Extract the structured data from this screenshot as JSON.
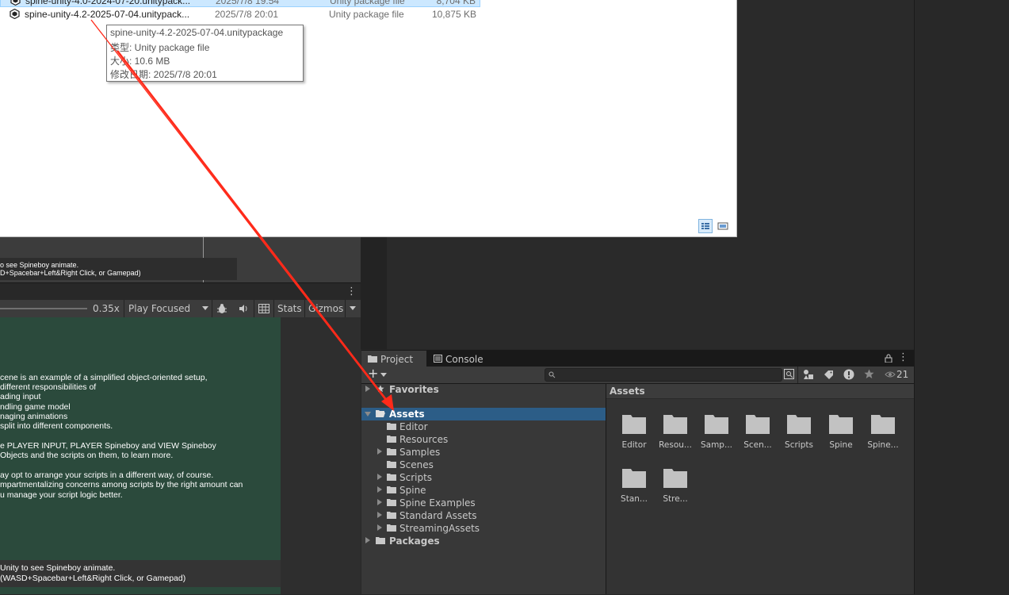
{
  "explorer": {
    "files": [
      {
        "name": "spine-unity-4.0-2024-07-20.unitypack...",
        "date": "2025/7/8 19:54",
        "type": "Unity package file",
        "size": "8,704 KB",
        "selected": true
      },
      {
        "name": "spine-unity-4.2-2025-07-04.unitypack...",
        "date": "2025/7/8 20:01",
        "type": "Unity package file",
        "size": "10,875 KB",
        "selected": false
      }
    ],
    "tooltip": {
      "name": "spine-unity-4.2-2025-07-04.unitypackage",
      "type_line": "类型: Unity package file",
      "size_line": "大小: 10.6 MB",
      "date_line": "修改日期: 2025/7/8 20:01"
    }
  },
  "scene": {
    "hint_line1": "o see Spineboy animate.",
    "hint_line2": "D+Spacebar+Left&Right Click, or Gamepad)"
  },
  "game_toolbar": {
    "scale": "0.35x",
    "play_mode": "Play Focused",
    "stats": "Stats",
    "gizmos": "Gizmos"
  },
  "game_view": {
    "lines": [
      "cene is an example of a simplified object-oriented setup,",
      "different responsibilities of",
      "ading input",
      "ndling game model",
      "naging animations",
      "split into different components.",
      "e PLAYER INPUT, PLAYER Spineboy and VIEW Spineboy",
      "Objects and the scripts on them, to learn more.",
      "ay opt to arrange your scripts in a different way, of course.",
      "mpartmentalizing concerns among scripts by the right amount can",
      "u manage your script logic better."
    ],
    "hint_line1": "Unity to see Spineboy animate.",
    "hint_line2": "(WASD+Spacebar+Left&Right Click, or Gamepad)"
  },
  "project": {
    "tabs": [
      {
        "label": "Project",
        "icon": "folder-icon"
      },
      {
        "label": "Console",
        "icon": "console-icon"
      }
    ],
    "add_label": "+",
    "visibility_count": "21",
    "tree": [
      {
        "label": "Favorites",
        "level": 0,
        "arrow": "right",
        "icon": "star-icon",
        "bold": true
      },
      {
        "label": "Assets",
        "level": 0,
        "arrow": "down",
        "icon": "folder-open-icon",
        "bold": true,
        "selected": true
      },
      {
        "label": "Editor",
        "level": 1,
        "arrow": "none"
      },
      {
        "label": "Resources",
        "level": 1,
        "arrow": "none"
      },
      {
        "label": "Samples",
        "level": 1,
        "arrow": "right"
      },
      {
        "label": "Scenes",
        "level": 1,
        "arrow": "none"
      },
      {
        "label": "Scripts",
        "level": 1,
        "arrow": "right"
      },
      {
        "label": "Spine",
        "level": 1,
        "arrow": "right"
      },
      {
        "label": "Spine Examples",
        "level": 1,
        "arrow": "right"
      },
      {
        "label": "Standard Assets",
        "level": 1,
        "arrow": "right"
      },
      {
        "label": "StreamingAssets",
        "level": 1,
        "arrow": "right"
      },
      {
        "label": "Packages",
        "level": 0,
        "arrow": "right",
        "bold": true
      }
    ],
    "grid_title": "Assets",
    "grid_items": [
      "Editor",
      "Resou...",
      "Samp...",
      "Scen...",
      "Scripts",
      "Spine",
      "Spine...",
      "Stan...",
      "Stre..."
    ]
  },
  "colors": {
    "selection_blue": "#2c5d87",
    "drag_arrow": "#ff2a1a",
    "game_bg": "#2b4a3c"
  }
}
